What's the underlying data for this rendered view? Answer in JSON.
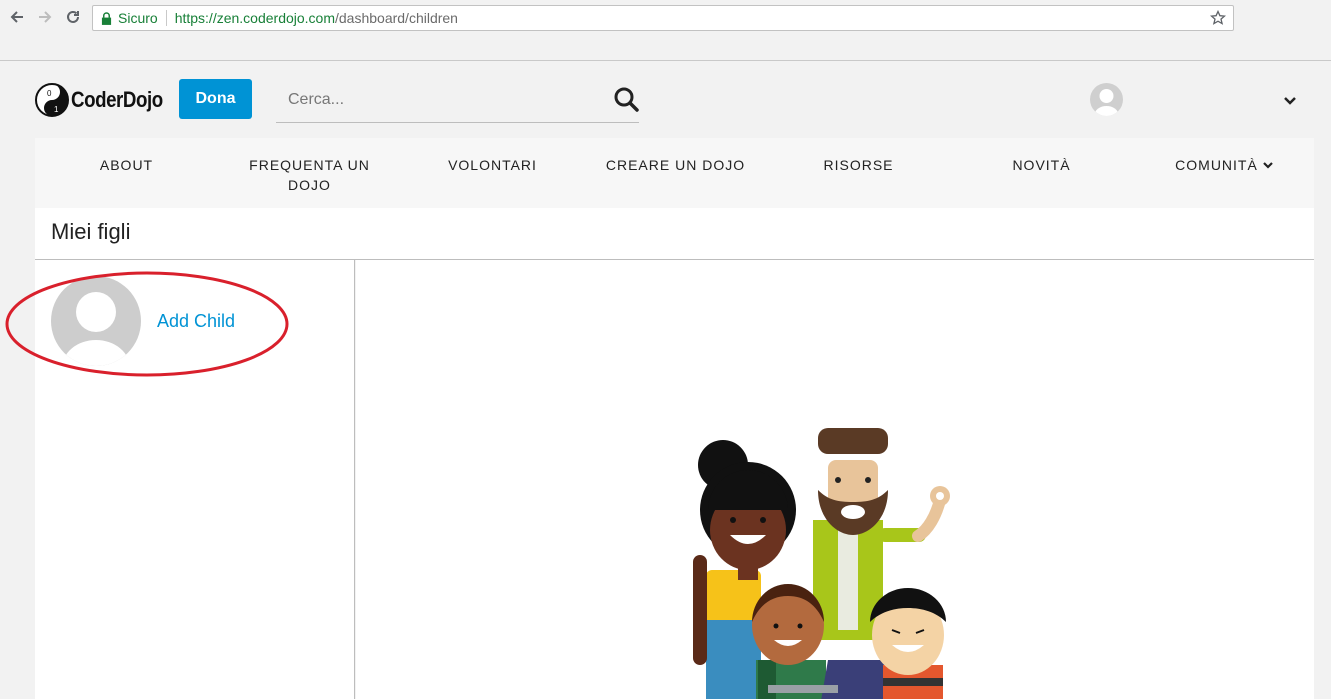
{
  "browser": {
    "secure_label": "Sicuro",
    "url_host": "https://zen.coderdojo.com",
    "url_path": "/dashboard/children"
  },
  "header": {
    "logo_text": "CoderDojo",
    "donate_label": "Dona",
    "search_placeholder": "Cerca..."
  },
  "nav": {
    "items": [
      {
        "label": "ABOUT"
      },
      {
        "label": "FREQUENTA UN DOJO"
      },
      {
        "label": "VOLONTARI"
      },
      {
        "label": "CREARE UN DOJO"
      },
      {
        "label": "RISORSE"
      },
      {
        "label": "NOVITÀ"
      },
      {
        "label": "COMUNITÀ"
      }
    ]
  },
  "page": {
    "title": "Miei figli",
    "add_child_label": "Add Child"
  },
  "colors": {
    "brand_blue": "#0093d5",
    "annotation_red": "#d9202c",
    "secure_green": "#188038"
  }
}
